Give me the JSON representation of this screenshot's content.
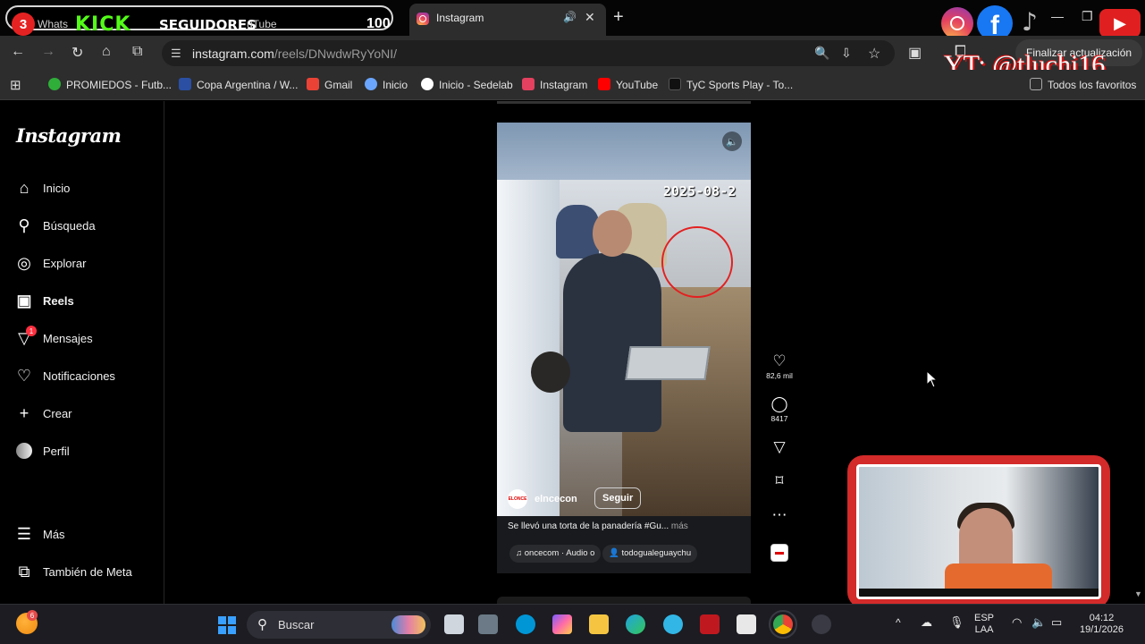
{
  "browser": {
    "tabs": [
      {
        "label_start": "Whats",
        "kick": "KICK",
        "seguidores": "SEGUIDORES",
        "label_end": "uTube",
        "count": "100",
        "badge": "3"
      },
      {
        "label": "Instagram",
        "active": true
      }
    ],
    "url_host": "instagram.com",
    "url_path": "/reels/DNwdwRyYoNI/",
    "update_button": "Finalizar actualización",
    "all_favorites": "Todos los favoritos"
  },
  "overlay": {
    "yt_handle": "YT: @tluchi16"
  },
  "bookmarks": [
    {
      "label": "PROMIEDOS - Futb...",
      "color": "#2fae3a"
    },
    {
      "label": "Copa Argentina / W...",
      "color": "#2a4fa3"
    },
    {
      "label": "Gmail",
      "color": "#ea4335"
    },
    {
      "label": "Inicio",
      "color": "#6aa5ff"
    },
    {
      "label": "Inicio - Sedelab",
      "color": "#ffffff"
    },
    {
      "label": "Instagram",
      "color": "#e4405f"
    },
    {
      "label": "YouTube",
      "color": "#ff0000"
    },
    {
      "label": "TyC Sports Play - To...",
      "color": "#111111"
    }
  ],
  "sidebar": {
    "logo": "Instagram",
    "items": [
      {
        "label": "Inicio",
        "icon": "home-icon"
      },
      {
        "label": "Búsqueda",
        "icon": "search-icon"
      },
      {
        "label": "Explorar",
        "icon": "compass-icon"
      },
      {
        "label": "Reels",
        "icon": "reels-icon"
      },
      {
        "label": "Mensajes",
        "icon": "messenger-icon",
        "badge": "1"
      },
      {
        "label": "Notificaciones",
        "icon": "heart-icon"
      },
      {
        "label": "Crear",
        "icon": "plus-icon"
      },
      {
        "label": "Perfil",
        "icon": "avatar-icon"
      }
    ],
    "more": "Más",
    "meta": "También de Meta"
  },
  "reel": {
    "cctv_date": "2025-08-2",
    "username": "elncecon",
    "avatar_text": "ELONCE",
    "follow": "Seguir",
    "caption": "Se llevó una torta de la panadería #Gu...",
    "caption_more": "más",
    "audio": "oncecom · Audio o",
    "tagged": "todogualeguaychu",
    "likes": "82,6 mil",
    "comments": "8417"
  },
  "taskbar": {
    "search_label": "Buscar",
    "weather_badge": "6",
    "lang_top": "ESP",
    "lang_bottom": "LAA",
    "time": "04:12",
    "date": "19/1/2026"
  }
}
